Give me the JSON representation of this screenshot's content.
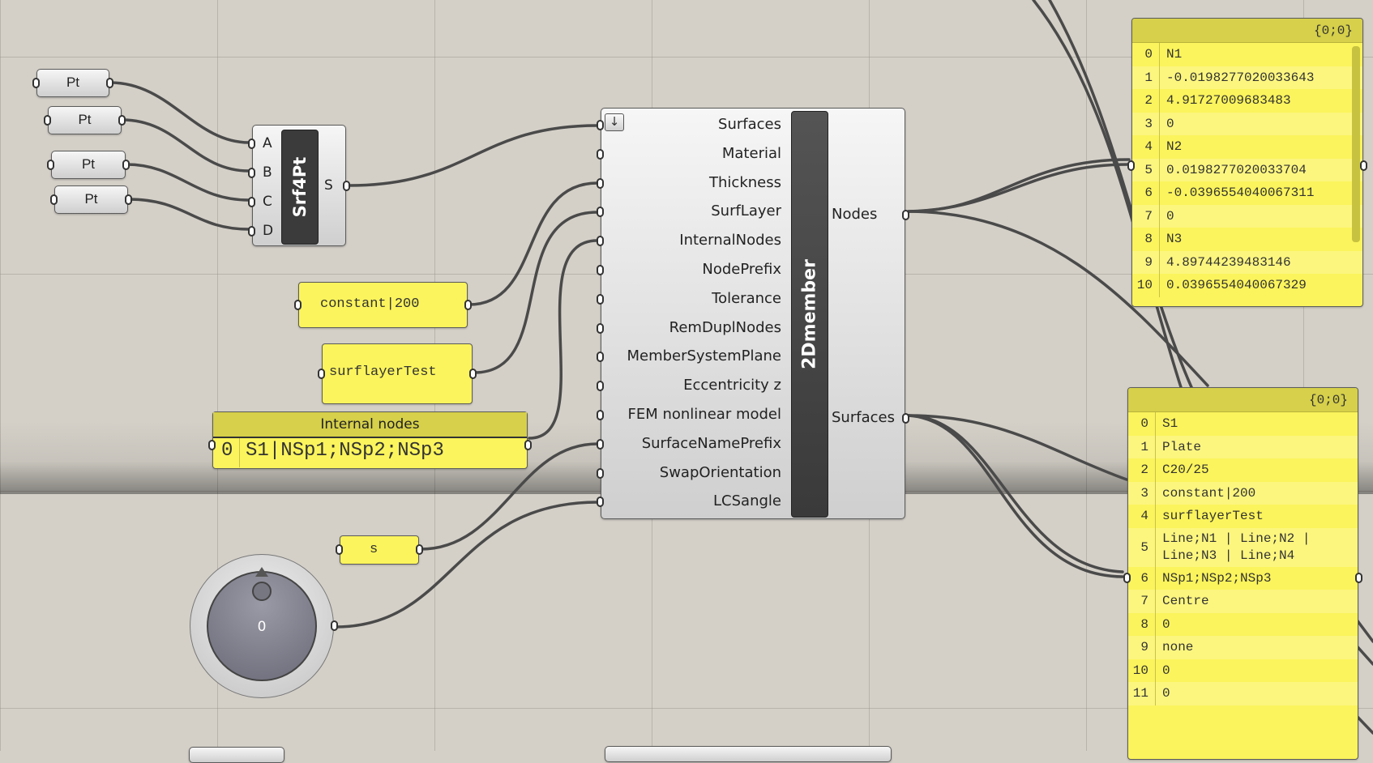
{
  "colors": {
    "canvas": "#d4d0c8",
    "wire": "#4a4a4a",
    "panel_yellow": "#fbf45c",
    "component_dark": "#3b3b3b"
  },
  "pt_params": [
    "Pt",
    "Pt",
    "Pt",
    "Pt"
  ],
  "srf4pt": {
    "name": "Srf4Pt",
    "inputs": [
      "A",
      "B",
      "C",
      "D"
    ],
    "output": "S"
  },
  "material_panel": {
    "text": "constant|200"
  },
  "surflayer_panel": {
    "text": "surflayerTest"
  },
  "internal_nodes_panel": {
    "title": "Internal nodes",
    "index": "0",
    "value": "S1|NSp1;NSp2;NSp3"
  },
  "s_panel": {
    "text": "s"
  },
  "dial": {
    "value": "0"
  },
  "member": {
    "name": "2Dmember",
    "inputs": [
      "Surfaces",
      "Material",
      "Thickness",
      "SurfLayer",
      "InternalNodes",
      "NodePrefix",
      "Tolerance",
      "RemDuplNodes",
      "MemberSystemPlane",
      "Eccentricity z",
      "FEM nonlinear model",
      "SurfaceNamePrefix",
      "SwapOrientation",
      "LCSangle"
    ],
    "outputs": [
      "Nodes",
      "Surfaces"
    ]
  },
  "nodes_panel": {
    "path": "{0;0}",
    "rows": [
      {
        "i": "0",
        "v": "N1"
      },
      {
        "i": "1",
        "v": "-0.0198277020033643"
      },
      {
        "i": "2",
        "v": "4.91727009683483"
      },
      {
        "i": "3",
        "v": "0"
      },
      {
        "i": "4",
        "v": "N2"
      },
      {
        "i": "5",
        "v": "0.0198277020033704"
      },
      {
        "i": "6",
        "v": "-0.0396554040067311"
      },
      {
        "i": "7",
        "v": "0"
      },
      {
        "i": "8",
        "v": "N3"
      },
      {
        "i": "9",
        "v": "4.89744239483146"
      },
      {
        "i": "10",
        "v": "0.0396554040067329"
      }
    ]
  },
  "surfaces_panel": {
    "path": "{0;0}",
    "rows": [
      {
        "i": "0",
        "v": "S1"
      },
      {
        "i": "1",
        "v": "Plate"
      },
      {
        "i": "2",
        "v": "C20/25"
      },
      {
        "i": "3",
        "v": "constant|200"
      },
      {
        "i": "4",
        "v": "surflayerTest"
      },
      {
        "i": "5",
        "v": "Line;N1 | Line;N2 |\nLine;N3 | Line;N4"
      },
      {
        "i": "6",
        "v": "NSp1;NSp2;NSp3"
      },
      {
        "i": "7",
        "v": "Centre"
      },
      {
        "i": "8",
        "v": "0"
      },
      {
        "i": "9",
        "v": "none"
      },
      {
        "i": "10",
        "v": "0"
      },
      {
        "i": "11",
        "v": "0"
      }
    ]
  }
}
